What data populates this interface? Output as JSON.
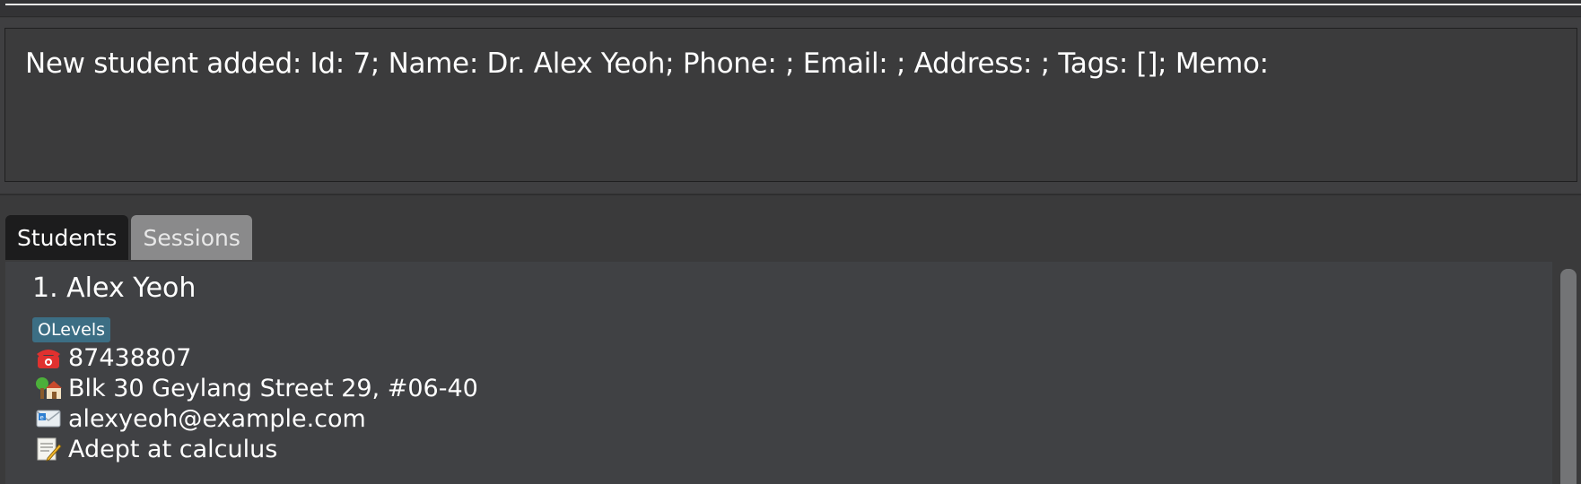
{
  "result_display": {
    "text": "New student added: Id: 7; Name: Dr. Alex Yeoh; Phone: ; Email: ; Address: ; Tags: []; Memo:"
  },
  "tabs": [
    {
      "label": "Students",
      "active": true
    },
    {
      "label": "Sessions",
      "active": false
    }
  ],
  "students": [
    {
      "index_name": "1. Alex Yeoh",
      "tags": [
        "OLevels"
      ],
      "phone": "87438807",
      "address": "Blk 30 Geylang Street 29, #06-40",
      "email": "alexyeoh@example.com",
      "memo": "Adept at calculus"
    }
  ],
  "icons": {
    "phone": "telephone-icon",
    "address": "house-icon",
    "email": "email-icon",
    "memo": "memo-icon"
  },
  "colors": {
    "background": "#3a3a3b",
    "tag": "#3c6e84",
    "active_tab": "#1c1c1d",
    "inactive_tab": "#8a8a8b"
  }
}
